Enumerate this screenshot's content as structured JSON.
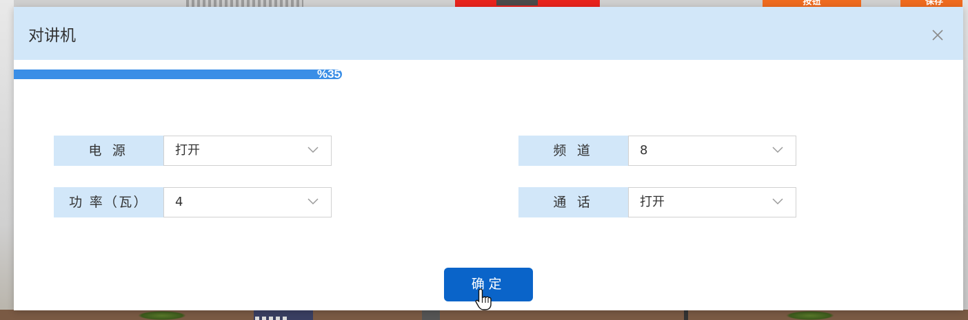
{
  "background": {
    "btn1_label": "按钮",
    "btn2_label": "保存"
  },
  "dialog": {
    "title": "对讲机",
    "close_icon": "close-icon",
    "progress": {
      "value": 0.35,
      "label": "%35",
      "color": "#3a8ee6"
    },
    "fields": {
      "power": {
        "label": "电 源",
        "value": "打开"
      },
      "channel": {
        "label": "频 道",
        "value": "8"
      },
      "wattage": {
        "label": "功 率（瓦）",
        "value": "4"
      },
      "call": {
        "label": "通 话",
        "value": "打开"
      }
    },
    "confirm_label": "确定"
  },
  "colors": {
    "header_bg": "#d2e7f9",
    "label_bg": "#d2e7f9",
    "button_bg": "#0a64c9"
  }
}
